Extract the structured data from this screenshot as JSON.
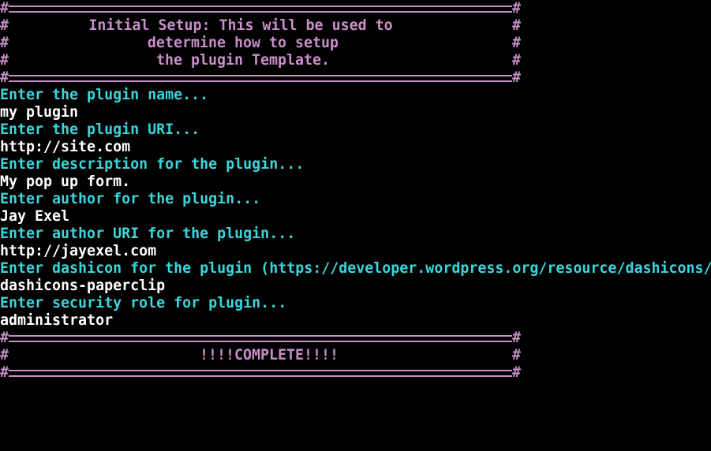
{
  "banner_color": "#c88fc8",
  "prompt_color": "#3ad6dc",
  "answer_color": "#ffffff",
  "hash_char": "#",
  "header": {
    "lines": [
      "Initial Setup: This will be used to",
      "determine how to setup",
      "the plugin Template."
    ]
  },
  "qa": [
    {
      "prompt": "Enter the plugin name...",
      "answer": "my plugin"
    },
    {
      "prompt": "Enter the plugin URI...",
      "answer": "http://site.com"
    },
    {
      "prompt": "Enter description for the plugin...",
      "answer": "My pop up form."
    },
    {
      "prompt": "Enter author for the plugin...",
      "answer": "Jay Exel"
    },
    {
      "prompt": "Enter author URI for the plugin...",
      "answer": "http://jayexel.com"
    },
    {
      "prompt": "Enter dashicon for the plugin (https://developer.wordpress.org/resource/dashicons/",
      "answer": "dashicons-paperclip"
    },
    {
      "prompt": "Enter security role for plugin...",
      "answer": "administrator"
    }
  ],
  "footer": {
    "message": "!!!!COMPLETE!!!!"
  }
}
